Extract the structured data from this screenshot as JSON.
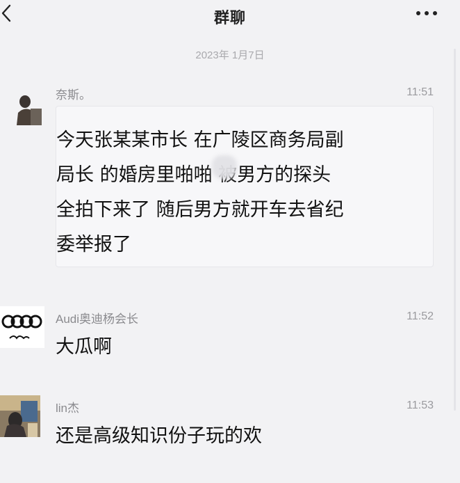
{
  "header": {
    "back_icon": "back-chevron-icon",
    "title": "群聊",
    "more_icon": "more-dots-icon"
  },
  "chat": {
    "date": "2023年 1月7日",
    "messages": [
      {
        "sender": "奈斯。",
        "time": "11:51",
        "lines": [
          "今天张某某市长 在广陵区商务局副",
          "局长 的婚房里啪啪 被男方的探头",
          "全拍下来了 随后男方就开车去省纪",
          "委举报了"
        ]
      },
      {
        "sender": "Audi奥迪杨会长",
        "time": "11:52",
        "text": "大瓜啊"
      },
      {
        "sender": "lin杰",
        "time": "11:53",
        "text": "还是高级知识份子玩的欢"
      }
    ]
  }
}
